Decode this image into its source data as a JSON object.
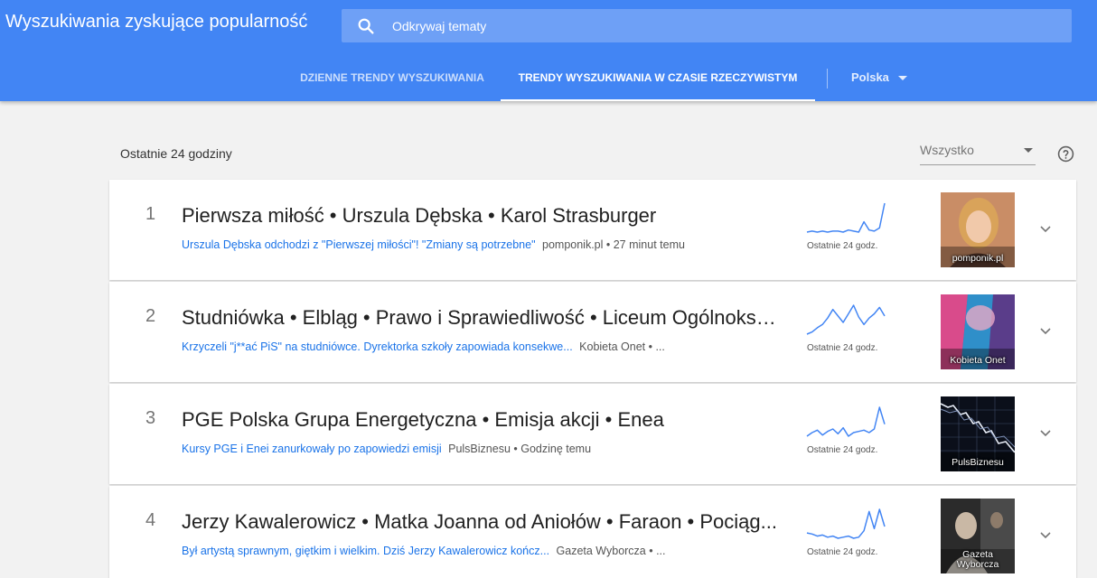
{
  "header": {
    "title": "Wyszukiwania zyskujące popularność",
    "search": {
      "placeholder": "Odkrywaj tematy",
      "value": ""
    },
    "tabs": [
      {
        "label": "DZIENNE TRENDY WYSZUKIWANIA",
        "active": false
      },
      {
        "label": "TRENDY WYSZUKIWANIA W CZASIE RZECZYWISTYM",
        "active": true
      }
    ],
    "country": "Polska",
    "colors": {
      "brand": "#4285f4",
      "search_box": "#6ea0f6"
    }
  },
  "toolbar": {
    "period_label": "Ostatnie 24 godziny",
    "filter_value": "Wszystko",
    "help_icon": "help-circle-icon"
  },
  "trends": [
    {
      "rank": "1",
      "title": "Pierwsza miłość • Urszula Dębska • Karol Strasburger",
      "article_title": "Urszula Dębska odchodzi z \"Pierwszej miłości\"! \"Zmiany są potrzebne\"",
      "article_meta": "pomponik.pl • 27 minut temu",
      "spark_label": "Ostatnie 24 godz.",
      "thumb_source": "pomponik.pl",
      "trend": [
        2,
        3,
        2,
        3,
        2,
        3,
        3,
        2,
        4,
        3,
        2,
        12,
        4,
        3,
        6,
        30
      ]
    },
    {
      "rank": "2",
      "title": "Studniówka • Elbląg • Prawo i Sprawiedliwość • Liceum Ogólnoksz...",
      "article_title": "Krzyczeli \"j**ać PiS\" na studniówce. Dyrektorka szkoły zapowiada konsekwe...",
      "article_meta": "Kobieta Onet • ...",
      "spark_label": "Ostatnie 24 godz.",
      "thumb_source": "Kobieta Onet",
      "trend": [
        3,
        5,
        9,
        12,
        18,
        26,
        20,
        14,
        22,
        30,
        19,
        12,
        18,
        22,
        28,
        20
      ]
    },
    {
      "rank": "3",
      "title": "PGE Polska Grupa Energetyczna • Emisja akcji • Enea",
      "article_title": "Kursy PGE i Enei zanurkowały po zapowiedzi emisji",
      "article_meta": "PulsBiznesu • Godzinę temu",
      "spark_label": "Ostatnie 24 godz.",
      "thumb_source": "PulsBiznesu",
      "trend": [
        6,
        9,
        11,
        7,
        10,
        12,
        8,
        13,
        6,
        9,
        10,
        11,
        9,
        12,
        30,
        16
      ]
    },
    {
      "rank": "4",
      "title": "Jerzy Kawalerowicz • Matka Joanna od Aniołów • Faraon • Pociąg...",
      "article_title": "Był artystą sprawnym, giętkim i wielkim. Dziś Jerzy Kawalerowicz kończ...",
      "article_meta": "Gazeta Wyborcza • ...",
      "spark_label": "Ostatnie 24 godz.",
      "thumb_source": "Gazeta\nWyborcza",
      "trend": [
        8,
        7,
        5,
        6,
        4,
        5,
        3,
        4,
        5,
        3,
        4,
        10,
        28,
        12,
        30,
        14
      ]
    }
  ]
}
